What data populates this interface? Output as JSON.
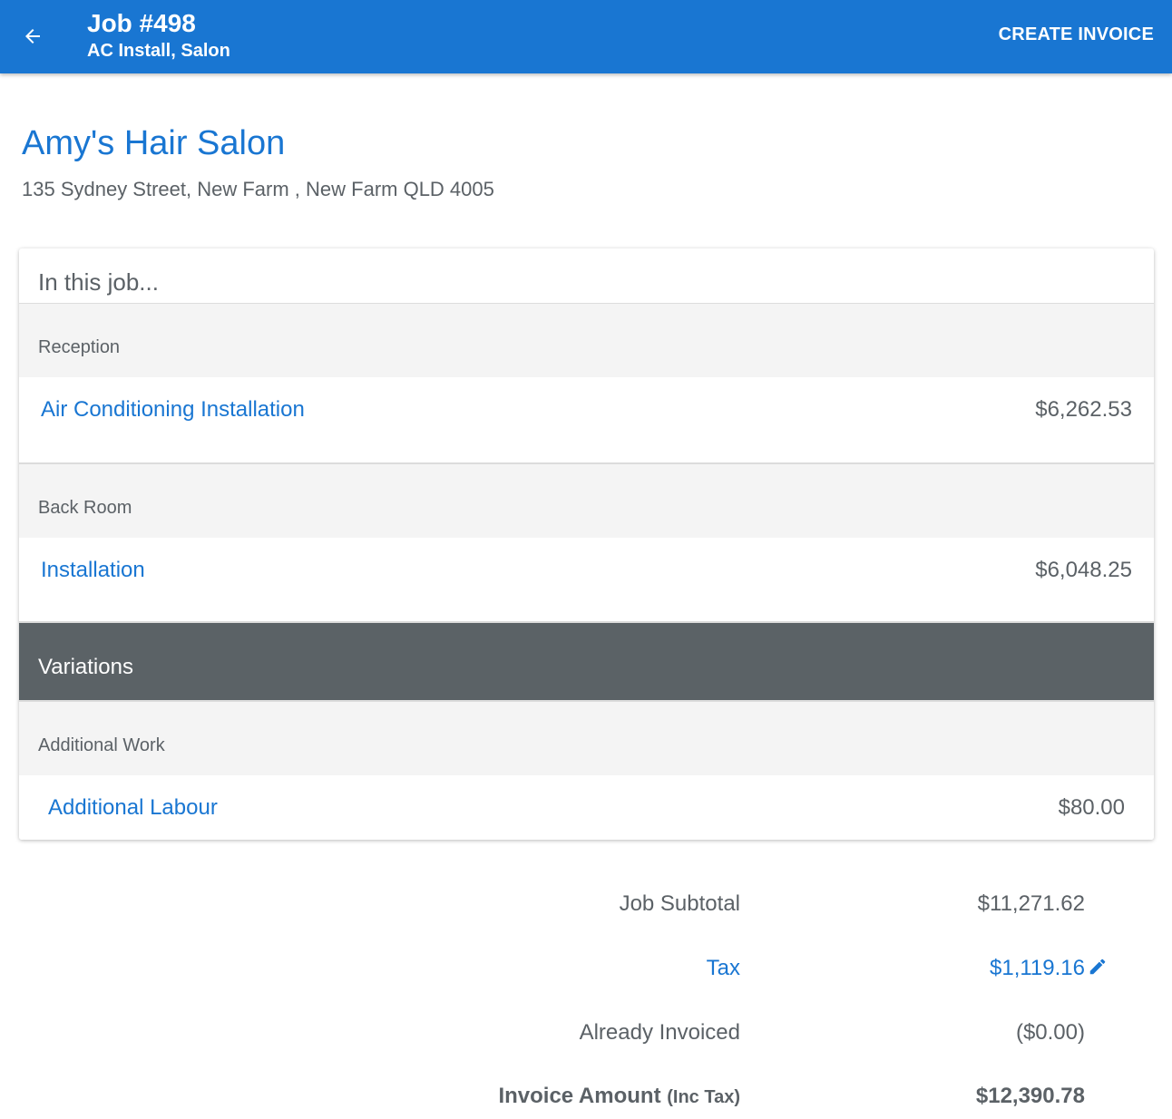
{
  "colors": {
    "primary": "#1976d2",
    "text": "#5b6166",
    "variations_bar": "#5b6266",
    "group_bg": "#f4f4f4"
  },
  "appbar": {
    "back_icon": "arrow-left-icon",
    "title": "Job #498",
    "subtitle": "AC Install, Salon",
    "action_label": "CREATE INVOICE"
  },
  "customer": {
    "name": "Amy's Hair Salon",
    "address": "135 Sydney Street, New Farm , New Farm QLD 4005"
  },
  "job_card": {
    "header": "In this job...",
    "groups": [
      {
        "name": "Reception",
        "items": [
          {
            "label": "Air Conditioning Installation",
            "amount": "$6,262.53"
          }
        ]
      },
      {
        "name": "Back Room",
        "items": [
          {
            "label": "Installation",
            "amount": "$6,048.25"
          }
        ]
      }
    ],
    "variations": {
      "title": "Variations",
      "groups": [
        {
          "name": "Additional Work",
          "items": [
            {
              "label": "Additional Labour",
              "amount": "$80.00"
            }
          ]
        }
      ]
    }
  },
  "summary": {
    "subtotal_label": "Job Subtotal",
    "subtotal_value": "$11,271.62",
    "tax_label": "Tax",
    "tax_value": "$1,119.16",
    "tax_edit_icon": "pencil-icon",
    "already_invoiced_label": "Already Invoiced",
    "already_invoiced_value": "($0.00)",
    "invoice_amount_label": "Invoice Amount",
    "invoice_amount_suffix": "(Inc Tax)",
    "invoice_amount_value": "$12,390.78"
  }
}
